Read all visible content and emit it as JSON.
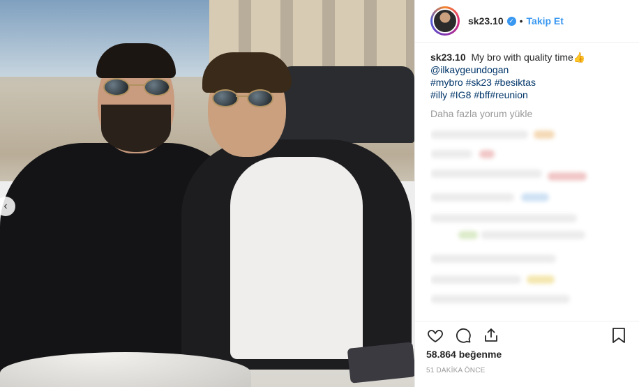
{
  "post": {
    "username": "sk23.10",
    "follow_label": "Takip Et",
    "separator": "•",
    "caption_text": "My bro with quality time👍",
    "caption_lines": {
      "mention": "@ilkaygeundogan",
      "tags1": "#mybro #sk23 #besiktas",
      "tags2": "#illy #IG8 #bff#reunion"
    },
    "load_more_comments": "Daha fazla yorum yükle",
    "likes": "58.864 beğenme",
    "timestamp": "51 DAKİKA ÖNCE"
  },
  "icons": {
    "verified": "verified-badge-icon",
    "like": "heart-icon",
    "comment": "comment-icon",
    "share": "share-icon",
    "save": "bookmark-icon",
    "carousel": "chevron-left-icon"
  },
  "colors": {
    "link": "#003569",
    "accent": "#3897f0",
    "muted": "#999999"
  }
}
